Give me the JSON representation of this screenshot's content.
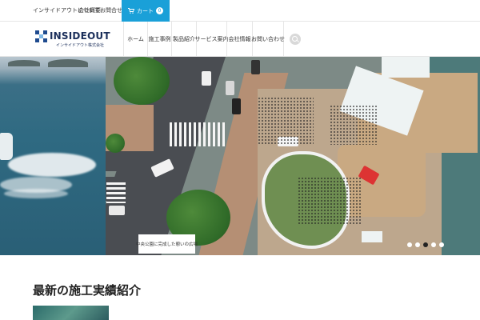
{
  "topbar": {
    "links": [
      "インサイドアウトについて",
      "会社概要",
      "お問合せ"
    ],
    "cart_label": "カート",
    "cart_count": "0"
  },
  "header": {
    "logo_text": "INSIDEOUT",
    "logo_subtext": "インサイドアウト株式会社",
    "nav_items": [
      "ホーム",
      "施工事例",
      "製品紹介",
      "サービス案内",
      "会社情報",
      "お問い合わせ"
    ]
  },
  "hero": {
    "caption": "中央公園に完成した憩いの広場",
    "slides_total": 5,
    "active_slide": 3
  },
  "section": {
    "title": "最新の施工実績紹介"
  },
  "colors": {
    "accent": "#1aa0d8",
    "brand": "#1f4b8f"
  }
}
